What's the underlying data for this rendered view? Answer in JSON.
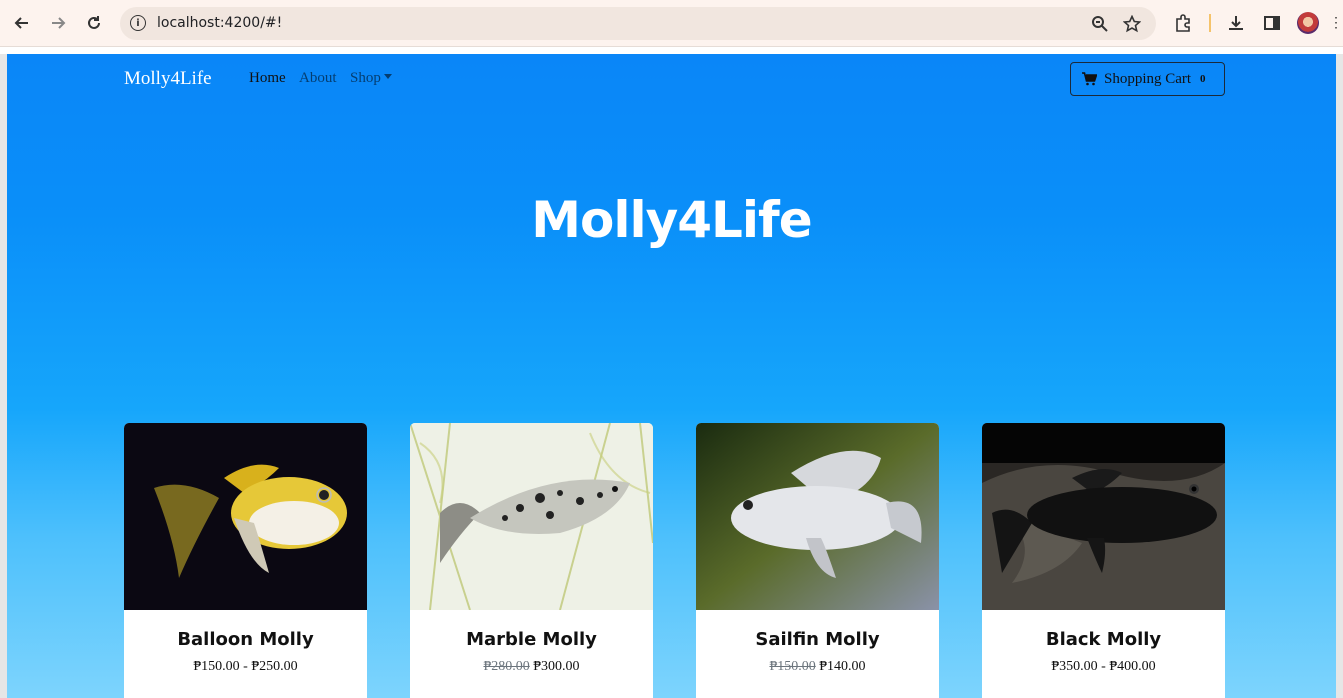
{
  "browser": {
    "url": "localhost:4200/#!",
    "icons": [
      "back-arrow-icon",
      "forward-arrow-icon",
      "reload-icon",
      "info-icon",
      "zoom-icon",
      "star-icon",
      "extensions-icon",
      "download-icon",
      "sidepanel-icon",
      "avatar",
      "kebab-icon"
    ]
  },
  "navbar": {
    "brand": "Molly4Life",
    "links": [
      {
        "label": "Home"
      },
      {
        "label": "About"
      },
      {
        "label": "Shop"
      }
    ],
    "cart_label": "Shopping Cart",
    "cart_count": "0"
  },
  "hero": {
    "title": "Molly4Life"
  },
  "products": [
    {
      "name": "Balloon Molly",
      "old_price": "",
      "price": "₱150.00 - ₱250.00"
    },
    {
      "name": "Marble Molly",
      "old_price": "₱280.00",
      "price": "₱300.00"
    },
    {
      "name": "Sailfin Molly",
      "old_price": "₱150.00",
      "price": "₱140.00"
    },
    {
      "name": "Black Molly",
      "old_price": "",
      "price": "₱350.00 - ₱400.00"
    }
  ],
  "colors": {
    "hero_top": "#0a86f8",
    "hero_bottom": "#7dd4fd"
  }
}
